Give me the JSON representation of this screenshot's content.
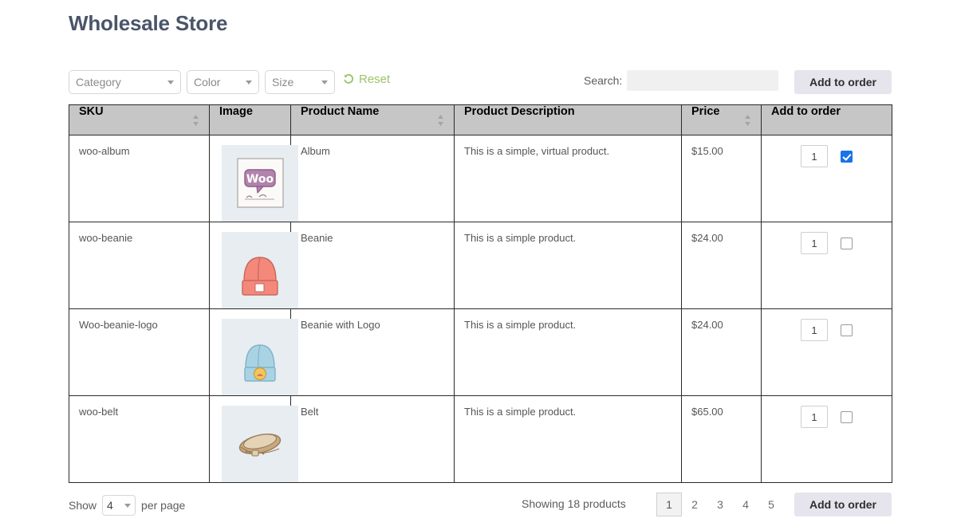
{
  "page_title": "Wholesale Store",
  "toolbar": {
    "filters": [
      {
        "name": "category",
        "label": "Category"
      },
      {
        "name": "color",
        "label": "Color"
      },
      {
        "name": "size",
        "label": "Size"
      }
    ],
    "reset_label": "Reset",
    "reset_icon": "undo-arrow-icon",
    "search_label": "Search:",
    "search_value": "",
    "search_placeholder": "",
    "add_to_order_label": "Add to order"
  },
  "table": {
    "columns": [
      {
        "key": "sku",
        "label": "SKU",
        "sortable": true
      },
      {
        "key": "image",
        "label": "Image",
        "sortable": false
      },
      {
        "key": "name",
        "label": "Product Name",
        "sortable": true
      },
      {
        "key": "desc",
        "label": "Product Description",
        "sortable": false
      },
      {
        "key": "price",
        "label": "Price",
        "sortable": true
      },
      {
        "key": "add",
        "label": "Add to order",
        "sortable": false
      }
    ],
    "rows": [
      {
        "sku": "woo-album",
        "image_alt": "album-thumbnail",
        "name": "Album",
        "desc": "This is a simple, virtual product.",
        "price": "$15.00",
        "qty": "1",
        "checked": true
      },
      {
        "sku": "woo-beanie",
        "image_alt": "beanie-thumbnail",
        "name": "Beanie",
        "desc": "This is a simple product.",
        "price": "$24.00",
        "qty": "1",
        "checked": false
      },
      {
        "sku": "Woo-beanie-logo",
        "image_alt": "beanie-with-logo-thumbnail",
        "name": "Beanie with Logo",
        "desc": "This is a simple product.",
        "price": "$24.00",
        "qty": "1",
        "checked": false
      },
      {
        "sku": "woo-belt",
        "image_alt": "belt-thumbnail",
        "name": "Belt",
        "desc": "This is a simple product.",
        "price": "$65.00",
        "qty": "1",
        "checked": false
      }
    ]
  },
  "footer": {
    "show_label": "Show",
    "per_page_value": "4",
    "per_page_label": "per page",
    "showing_text": "Showing 18 products",
    "pages": [
      "1",
      "2",
      "3",
      "4",
      "5"
    ],
    "active_page": "1",
    "add_to_order_label": "Add to order"
  },
  "colors": {
    "title": "#4a5568",
    "link_green": "#9ac566",
    "header_gray": "#c6c6c6",
    "button_lavender": "#e6e4ec",
    "checkbox_blue": "#1a73e8",
    "thumb_bg": "#e7edf1"
  }
}
